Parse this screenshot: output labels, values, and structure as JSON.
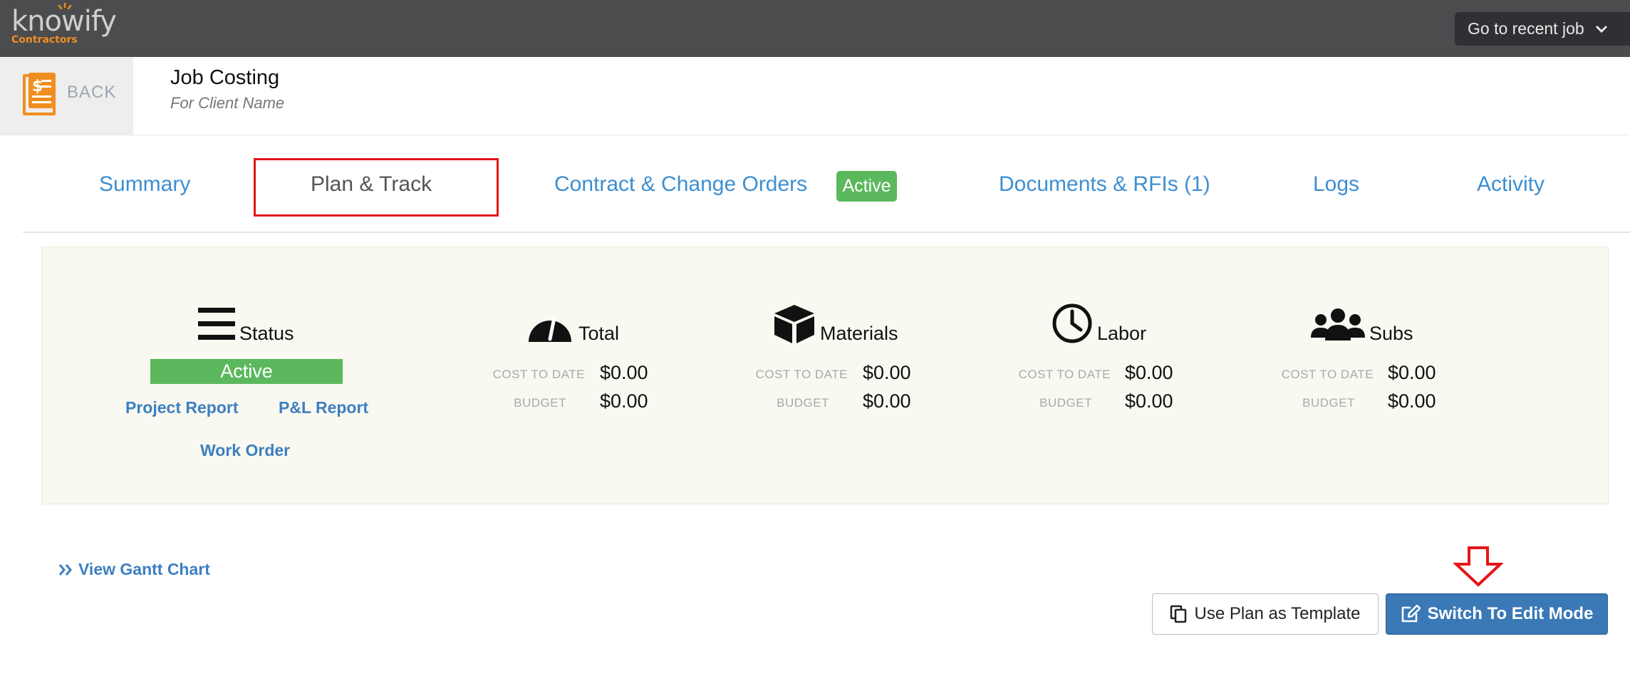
{
  "brand": {
    "name": "knowify",
    "sub": "Contractors"
  },
  "topbar": {
    "recent_job": "Go to recent job"
  },
  "header": {
    "back": "BACK",
    "title": "Job Costing",
    "subtitle": "For Client Name"
  },
  "tabs": [
    {
      "label": "Summary"
    },
    {
      "label": "Plan & Track"
    },
    {
      "label": "Contract & Change Orders",
      "badge": "Active"
    },
    {
      "label": "Documents & RFIs (1)"
    },
    {
      "label": "Logs"
    },
    {
      "label": "Activity"
    }
  ],
  "status": {
    "title": "Status",
    "value": "Active",
    "project_report": "Project Report",
    "pl_report": "P&L Report",
    "work_order": "Work Order"
  },
  "stats": [
    {
      "title": "Total",
      "icon": "speedometer-icon",
      "cost_label": "COST TO DATE",
      "cost": "$0.00",
      "budget_label": "BUDGET",
      "budget": "$0.00"
    },
    {
      "title": "Materials",
      "icon": "box-icon",
      "cost_label": "COST TO DATE",
      "cost": "$0.00",
      "budget_label": "BUDGET",
      "budget": "$0.00"
    },
    {
      "title": "Labor",
      "icon": "clock-icon",
      "cost_label": "COST TO DATE",
      "cost": "$0.00",
      "budget_label": "BUDGET",
      "budget": "$0.00"
    },
    {
      "title": "Subs",
      "icon": "people-icon",
      "cost_label": "COST TO DATE",
      "cost": "$0.00",
      "budget_label": "BUDGET",
      "budget": "$0.00"
    }
  ],
  "actions": {
    "gantt": "View Gantt Chart",
    "template": "Use Plan as Template",
    "edit": "Switch To Edit Mode"
  },
  "colors": {
    "accent": "#3d8fd1",
    "active": "#5cb85c",
    "highlight": "#e3151a",
    "primary_button": "#3a78b6",
    "topbar": "#4b4c4e"
  }
}
